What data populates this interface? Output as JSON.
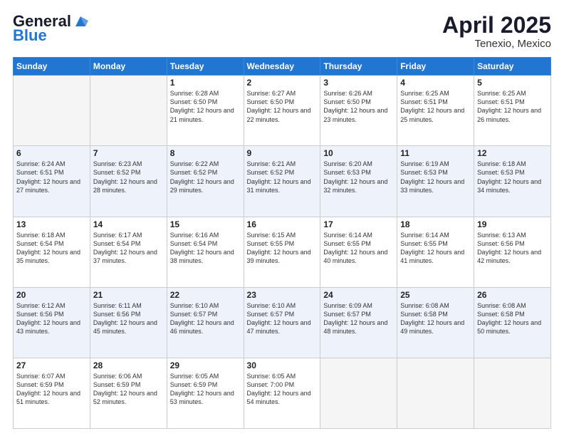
{
  "header": {
    "logo_general": "General",
    "logo_blue": "Blue",
    "title": "April 2025",
    "location": "Tenexio, Mexico"
  },
  "weekdays": [
    "Sunday",
    "Monday",
    "Tuesday",
    "Wednesday",
    "Thursday",
    "Friday",
    "Saturday"
  ],
  "weeks": [
    [
      {
        "day": "",
        "info": ""
      },
      {
        "day": "",
        "info": ""
      },
      {
        "day": "1",
        "info": "Sunrise: 6:28 AM\nSunset: 6:50 PM\nDaylight: 12 hours and 21 minutes."
      },
      {
        "day": "2",
        "info": "Sunrise: 6:27 AM\nSunset: 6:50 PM\nDaylight: 12 hours and 22 minutes."
      },
      {
        "day": "3",
        "info": "Sunrise: 6:26 AM\nSunset: 6:50 PM\nDaylight: 12 hours and 23 minutes."
      },
      {
        "day": "4",
        "info": "Sunrise: 6:25 AM\nSunset: 6:51 PM\nDaylight: 12 hours and 25 minutes."
      },
      {
        "day": "5",
        "info": "Sunrise: 6:25 AM\nSunset: 6:51 PM\nDaylight: 12 hours and 26 minutes."
      }
    ],
    [
      {
        "day": "6",
        "info": "Sunrise: 6:24 AM\nSunset: 6:51 PM\nDaylight: 12 hours and 27 minutes."
      },
      {
        "day": "7",
        "info": "Sunrise: 6:23 AM\nSunset: 6:52 PM\nDaylight: 12 hours and 28 minutes."
      },
      {
        "day": "8",
        "info": "Sunrise: 6:22 AM\nSunset: 6:52 PM\nDaylight: 12 hours and 29 minutes."
      },
      {
        "day": "9",
        "info": "Sunrise: 6:21 AM\nSunset: 6:52 PM\nDaylight: 12 hours and 31 minutes."
      },
      {
        "day": "10",
        "info": "Sunrise: 6:20 AM\nSunset: 6:53 PM\nDaylight: 12 hours and 32 minutes."
      },
      {
        "day": "11",
        "info": "Sunrise: 6:19 AM\nSunset: 6:53 PM\nDaylight: 12 hours and 33 minutes."
      },
      {
        "day": "12",
        "info": "Sunrise: 6:18 AM\nSunset: 6:53 PM\nDaylight: 12 hours and 34 minutes."
      }
    ],
    [
      {
        "day": "13",
        "info": "Sunrise: 6:18 AM\nSunset: 6:54 PM\nDaylight: 12 hours and 35 minutes."
      },
      {
        "day": "14",
        "info": "Sunrise: 6:17 AM\nSunset: 6:54 PM\nDaylight: 12 hours and 37 minutes."
      },
      {
        "day": "15",
        "info": "Sunrise: 6:16 AM\nSunset: 6:54 PM\nDaylight: 12 hours and 38 minutes."
      },
      {
        "day": "16",
        "info": "Sunrise: 6:15 AM\nSunset: 6:55 PM\nDaylight: 12 hours and 39 minutes."
      },
      {
        "day": "17",
        "info": "Sunrise: 6:14 AM\nSunset: 6:55 PM\nDaylight: 12 hours and 40 minutes."
      },
      {
        "day": "18",
        "info": "Sunrise: 6:14 AM\nSunset: 6:55 PM\nDaylight: 12 hours and 41 minutes."
      },
      {
        "day": "19",
        "info": "Sunrise: 6:13 AM\nSunset: 6:56 PM\nDaylight: 12 hours and 42 minutes."
      }
    ],
    [
      {
        "day": "20",
        "info": "Sunrise: 6:12 AM\nSunset: 6:56 PM\nDaylight: 12 hours and 43 minutes."
      },
      {
        "day": "21",
        "info": "Sunrise: 6:11 AM\nSunset: 6:56 PM\nDaylight: 12 hours and 45 minutes."
      },
      {
        "day": "22",
        "info": "Sunrise: 6:10 AM\nSunset: 6:57 PM\nDaylight: 12 hours and 46 minutes."
      },
      {
        "day": "23",
        "info": "Sunrise: 6:10 AM\nSunset: 6:57 PM\nDaylight: 12 hours and 47 minutes."
      },
      {
        "day": "24",
        "info": "Sunrise: 6:09 AM\nSunset: 6:57 PM\nDaylight: 12 hours and 48 minutes."
      },
      {
        "day": "25",
        "info": "Sunrise: 6:08 AM\nSunset: 6:58 PM\nDaylight: 12 hours and 49 minutes."
      },
      {
        "day": "26",
        "info": "Sunrise: 6:08 AM\nSunset: 6:58 PM\nDaylight: 12 hours and 50 minutes."
      }
    ],
    [
      {
        "day": "27",
        "info": "Sunrise: 6:07 AM\nSunset: 6:59 PM\nDaylight: 12 hours and 51 minutes."
      },
      {
        "day": "28",
        "info": "Sunrise: 6:06 AM\nSunset: 6:59 PM\nDaylight: 12 hours and 52 minutes."
      },
      {
        "day": "29",
        "info": "Sunrise: 6:05 AM\nSunset: 6:59 PM\nDaylight: 12 hours and 53 minutes."
      },
      {
        "day": "30",
        "info": "Sunrise: 6:05 AM\nSunset: 7:00 PM\nDaylight: 12 hours and 54 minutes."
      },
      {
        "day": "",
        "info": ""
      },
      {
        "day": "",
        "info": ""
      },
      {
        "day": "",
        "info": ""
      }
    ]
  ]
}
